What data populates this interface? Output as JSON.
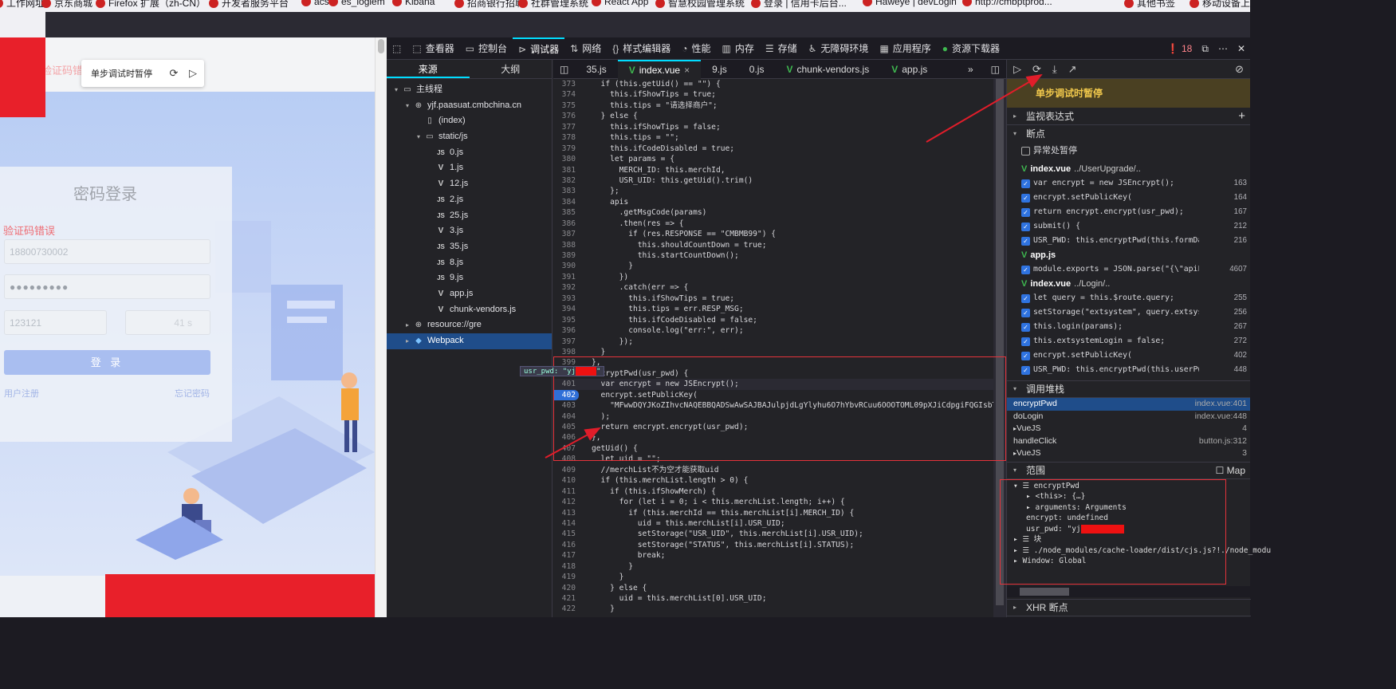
{
  "bookmarks": [
    {
      "label": "工作网址"
    },
    {
      "label": "京东商城"
    },
    {
      "label": "Firefox 扩展（zh-CN）"
    },
    {
      "label": "开发者服务平台"
    },
    {
      "label": "acs"
    },
    {
      "label": "es_logiem"
    },
    {
      "label": "Kibana"
    },
    {
      "label": "招商银行招聘"
    },
    {
      "label": "社群管理系统"
    },
    {
      "label": "React App"
    },
    {
      "label": "智慧校园管理系统"
    },
    {
      "label": "登录 | 信用卡后台..."
    },
    {
      "label": "Haweye | devLogin"
    },
    {
      "label": "http://cmbptprod..."
    },
    {
      "label": "其他书签"
    },
    {
      "label": "移动设备上的书签"
    }
  ],
  "page": {
    "faint_msg": "验证码错误",
    "pause_bar": {
      "text": "单步调试时暂停"
    },
    "login": {
      "title": "密码登录",
      "error": "验证码错误",
      "phone_value": "18800730002",
      "password_value": "●●●●●●●●●",
      "captcha_value": "123121",
      "countdown": "41 s",
      "login_button": "登 录",
      "register_link": "用户注册",
      "forgot_link": "忘记密码"
    }
  },
  "devtools": {
    "toolbar": {
      "tabs": [
        {
          "label": "查看器",
          "icon": "inspector-icon"
        },
        {
          "label": "控制台",
          "icon": "console-icon"
        },
        {
          "label": "调试器",
          "icon": "debugger-icon",
          "active": true
        },
        {
          "label": "网络",
          "icon": "network-icon"
        },
        {
          "label": "样式编辑器",
          "icon": "style-editor-icon"
        },
        {
          "label": "性能",
          "icon": "performance-icon"
        },
        {
          "label": "内存",
          "icon": "memory-icon"
        },
        {
          "label": "存储",
          "icon": "storage-icon"
        },
        {
          "label": "无障碍环境",
          "icon": "accessibility-icon"
        },
        {
          "label": "应用程序",
          "icon": "application-icon"
        },
        {
          "label": "资源下载器",
          "icon": "resource-downloader-icon"
        }
      ],
      "error_count": "18"
    },
    "sources": {
      "tabs": [
        "来源",
        "大纲"
      ],
      "tree": [
        {
          "label": "主线程",
          "indent": 0,
          "icon": "window",
          "twisty": "▾"
        },
        {
          "label": "yjf.paasuat.cmbchina.cn",
          "indent": 1,
          "icon": "globe",
          "twisty": "▾"
        },
        {
          "label": "(index)",
          "indent": 2,
          "icon": "file",
          "twisty": ""
        },
        {
          "label": "static/js",
          "indent": 2,
          "icon": "folder",
          "twisty": "▾"
        },
        {
          "label": "0.js",
          "indent": 3,
          "icon": "JS",
          "twisty": ""
        },
        {
          "label": "1.js",
          "indent": 3,
          "icon": "V",
          "twisty": ""
        },
        {
          "label": "12.js",
          "indent": 3,
          "icon": "V",
          "twisty": ""
        },
        {
          "label": "2.js",
          "indent": 3,
          "icon": "JS",
          "twisty": ""
        },
        {
          "label": "25.js",
          "indent": 3,
          "icon": "JS",
          "twisty": ""
        },
        {
          "label": "3.js",
          "indent": 3,
          "icon": "V",
          "twisty": ""
        },
        {
          "label": "35.js",
          "indent": 3,
          "icon": "JS",
          "twisty": ""
        },
        {
          "label": "8.js",
          "indent": 3,
          "icon": "JS",
          "twisty": ""
        },
        {
          "label": "9.js",
          "indent": 3,
          "icon": "JS",
          "twisty": ""
        },
        {
          "label": "app.js",
          "indent": 3,
          "icon": "V",
          "twisty": ""
        },
        {
          "label": "chunk-vendors.js",
          "indent": 3,
          "icon": "V",
          "twisty": ""
        },
        {
          "label": "resource://gre",
          "indent": 1,
          "icon": "globe",
          "twisty": "▸"
        },
        {
          "label": "Webpack",
          "indent": 1,
          "icon": "webpack",
          "twisty": "▸",
          "selected": true
        }
      ]
    },
    "editor": {
      "tabs": [
        {
          "label": "35.js",
          "vue": false
        },
        {
          "label": "index.vue",
          "vue": true,
          "active": true
        },
        {
          "label": "9.js",
          "vue": false
        },
        {
          "label": "0.js",
          "vue": false
        },
        {
          "label": "chunk-vendors.js",
          "vue": true
        },
        {
          "label": "app.js",
          "vue": true
        }
      ],
      "lines": [
        {
          "n": "373",
          "t": "  if (this.getUid() == \"\") {"
        },
        {
          "n": "374",
          "t": "    this.ifShowTips = true;"
        },
        {
          "n": "375",
          "t": "    this.tips = \"请选择商户\";"
        },
        {
          "n": "376",
          "t": "  } else {"
        },
        {
          "n": "377",
          "t": "    this.ifShowTips = false;"
        },
        {
          "n": "378",
          "t": "    this.tips = \"\";"
        },
        {
          "n": "379",
          "t": "    this.ifCodeDisabled = true;"
        },
        {
          "n": "380",
          "t": "    let params = {"
        },
        {
          "n": "381",
          "t": "      MERCH_ID: this.merchId,"
        },
        {
          "n": "382",
          "t": "      USR_UID: this.getUid().trim()"
        },
        {
          "n": "383",
          "t": "    };"
        },
        {
          "n": "384",
          "t": "    apis"
        },
        {
          "n": "385",
          "t": "      .getMsgCode(params)"
        },
        {
          "n": "386",
          "t": "      .then(res => {"
        },
        {
          "n": "387",
          "t": "        if (res.RESPONSE == \"CMBMB99\") {"
        },
        {
          "n": "388",
          "t": "          this.shouldCountDown = true;"
        },
        {
          "n": "389",
          "t": "          this.startCountDown();"
        },
        {
          "n": "390",
          "t": "        }"
        },
        {
          "n": "391",
          "t": "      })"
        },
        {
          "n": "392",
          "t": "      .catch(err => {"
        },
        {
          "n": "393",
          "t": "        this.ifShowTips = true;"
        },
        {
          "n": "394",
          "t": "        this.tips = err.RESP_MSG;"
        },
        {
          "n": "395",
          "t": "        this.ifCodeDisabled = false;"
        },
        {
          "n": "396",
          "t": "        console.log(\"err:\", err);"
        },
        {
          "n": "397",
          "t": "      });"
        },
        {
          "n": "398",
          "t": "  }"
        },
        {
          "n": "399",
          "t": "},"
        },
        {
          "n": "400",
          "t": "encryptPwd(usr_pwd) {"
        },
        {
          "n": "401",
          "t": "  var encrypt = new JSEncrypt();"
        },
        {
          "n": "402",
          "t": "  encrypt.setPublicKey(",
          "bp": true
        },
        {
          "n": "403",
          "t": "    \"MFwwDQYJKoZIhvcNAQEBBQADSwAwSAJBAJulpjdLgYlyhu6O7hYbvRCuu6OOOTOML09pXJiCdpgiFQGIsbTJuebH"
        },
        {
          "n": "404",
          "t": "  );"
        },
        {
          "n": "405",
          "t": "  return encrypt.encrypt(usr_pwd);"
        },
        {
          "n": "406",
          "t": "},"
        },
        {
          "n": "407",
          "t": "getUid() {"
        },
        {
          "n": "408",
          "t": "  let uid = \"\";"
        },
        {
          "n": "409",
          "t": "  //merchList不为空才能获取uid"
        },
        {
          "n": "410",
          "t": "  if (this.merchList.length > 0) {"
        },
        {
          "n": "411",
          "t": "    if (this.ifShowMerch) {"
        },
        {
          "n": "412",
          "t": "      for (let i = 0; i < this.merchList.length; i++) {"
        },
        {
          "n": "413",
          "t": "        if (this.merchId == this.merchList[i].MERCH_ID) {"
        },
        {
          "n": "414",
          "t": "          uid = this.merchList[i].USR_UID;"
        },
        {
          "n": "415",
          "t": "          setStorage(\"USR_UID\", this.merchList[i].USR_UID);"
        },
        {
          "n": "416",
          "t": "          setStorage(\"STATUS\", this.merchList[i].STATUS);"
        },
        {
          "n": "417",
          "t": "          break;"
        },
        {
          "n": "418",
          "t": "        }"
        },
        {
          "n": "419",
          "t": "      }"
        },
        {
          "n": "420",
          "t": "    } else {"
        },
        {
          "n": "421",
          "t": "      uid = this.merchList[0].USR_UID;"
        },
        {
          "n": "422",
          "t": "    }"
        }
      ],
      "tooltip_label": "usr_pwd: \"yj"
    },
    "debugger": {
      "paused_message": "单步调试时暂停",
      "watch_title": "监视表达式",
      "breakpoints_title": "断点",
      "pause_on_exceptions": "异常处暂停",
      "breakpoint_groups": [
        {
          "file": "index.vue",
          "path": "../UserUpgrade/..",
          "items": [
            {
              "code": "var encrypt = new JSEncrypt();",
              "line": "163"
            },
            {
              "code": "encrypt.setPublicKey(",
              "line": "164"
            },
            {
              "code": "return encrypt.encrypt(usr_pwd);",
              "line": "167"
            },
            {
              "code": "submit() {",
              "line": "212"
            },
            {
              "code": "USR_PWD: this.encryptPwd(this.formData.USR_PW…",
              "line": "216"
            }
          ]
        },
        {
          "file": "app.js",
          "path": "",
          "items": [
            {
              "code": "module.exports = JSON.parse(\"{\\\"apiList\\\":[{…",
              "line": "4607"
            }
          ]
        },
        {
          "file": "index.vue",
          "path": "../Login/..",
          "items": [
            {
              "code": "let query = this.$route.query;",
              "line": "255"
            },
            {
              "code": "setStorage(\"extsystem\", query.extsystem);",
              "line": "256"
            },
            {
              "code": "this.login(params);",
              "line": "267"
            },
            {
              "code": "this.extsystemLogin = false;",
              "line": "272"
            },
            {
              "code": "encrypt.setPublicKey(",
              "line": "402"
            },
            {
              "code": "USR_PWD: this.encryptPwd(this.userPwd),",
              "line": "448"
            }
          ]
        }
      ],
      "callstack_title": "调用堆栈",
      "callstack": [
        {
          "fn": "encryptPwd",
          "loc": "index.vue:401",
          "selected": true
        },
        {
          "fn": "doLogin",
          "loc": "index.vue:448"
        },
        {
          "fn": "VueJS",
          "loc": "4",
          "group": true
        },
        {
          "fn": "handleClick",
          "loc": "button.js:312"
        },
        {
          "fn": "VueJS",
          "loc": "3",
          "group": true
        }
      ],
      "scopes_title": "范围",
      "map_label": "Map",
      "scopes": [
        {
          "t": "▾ ☰ encryptPwd",
          "i": 0
        },
        {
          "t": "▸ <this>: {…}",
          "i": 1
        },
        {
          "t": "▸ arguments: Arguments",
          "i": 1
        },
        {
          "t": "encrypt: undefined",
          "i": 1
        },
        {
          "t": "usr_pwd: \"yj",
          "i": 1,
          "redact": true
        },
        {
          "t": "▸ ☰ 块",
          "i": 0
        },
        {
          "t": "▸ ☰ ./node_modules/cache-loader/dist/cjs.js?!./node_modu",
          "i": 0
        },
        {
          "t": "▸ Window: Global",
          "i": 0
        }
      ],
      "xhr_title": "XHR 断点"
    }
  }
}
